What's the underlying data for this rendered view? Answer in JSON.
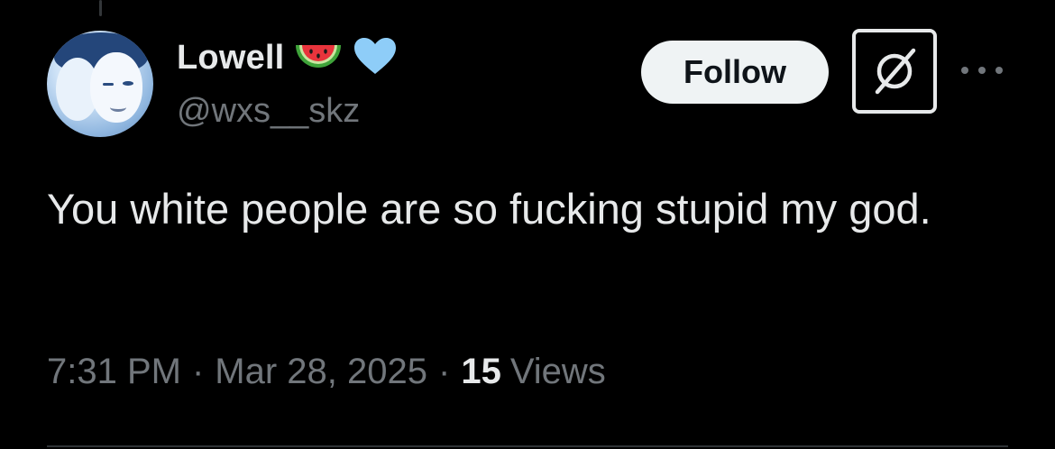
{
  "tweet": {
    "author": {
      "name": "Lowell",
      "handle": "@wxs__skz",
      "emoji": [
        "watermelon-icon",
        "blue-heart-icon"
      ]
    },
    "follow_label": "Follow",
    "text": "You white people are so fucking stupid my god.",
    "time": "7:31 PM",
    "separator": "·",
    "date": "Mar 28, 2025",
    "views_count": "15",
    "views_label": "Views"
  },
  "colors": {
    "background": "#000000",
    "primary_text": "#e7e9ea",
    "secondary_text": "#71767b",
    "follow_bg": "#eff3f4",
    "heart": "#8ecdf8"
  }
}
